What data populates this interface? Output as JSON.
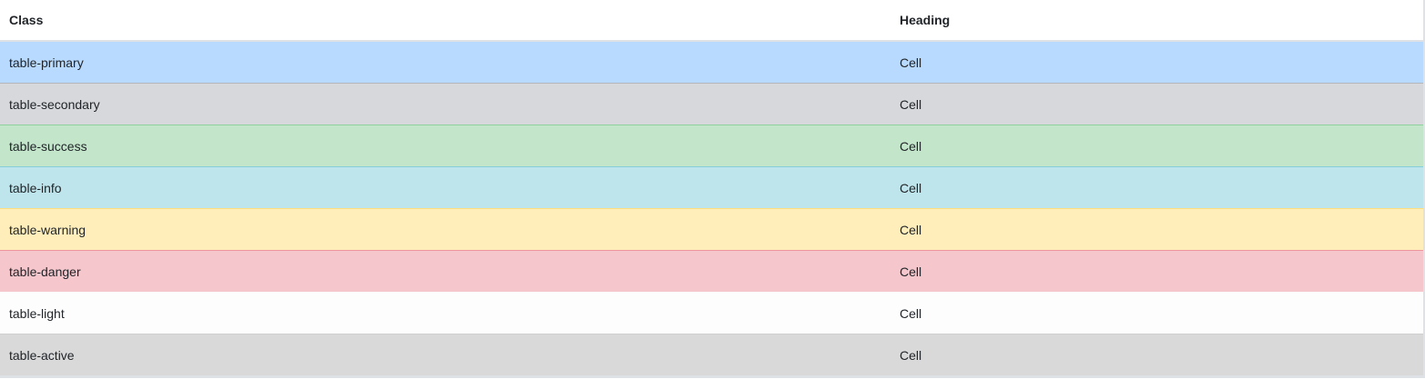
{
  "table": {
    "headers": [
      "Class",
      "Heading"
    ],
    "rows": [
      {
        "class_name": "table-primary",
        "cell": "Cell",
        "bg": "#b8daff",
        "border": "#7abaff"
      },
      {
        "class_name": "table-secondary",
        "cell": "Cell",
        "bg": "#d6d8db",
        "border": "#b3b7bb"
      },
      {
        "class_name": "table-success",
        "cell": "Cell",
        "bg": "#c3e6cb",
        "border": "#8fd19e"
      },
      {
        "class_name": "table-info",
        "cell": "Cell",
        "bg": "#bee5eb",
        "border": "#86cfda"
      },
      {
        "class_name": "table-warning",
        "cell": "Cell",
        "bg": "#ffeeba",
        "border": "#ffdf7e"
      },
      {
        "class_name": "table-danger",
        "cell": "Cell",
        "bg": "#f5c6cb",
        "border": "#ed969e"
      },
      {
        "class_name": "table-light",
        "cell": "Cell",
        "bg": "#fdfdfe",
        "border": "#fbfcfc"
      },
      {
        "class_name": "table-active",
        "cell": "Cell",
        "bg": "#d9d9d9",
        "border": "#cfcfcf"
      }
    ]
  }
}
